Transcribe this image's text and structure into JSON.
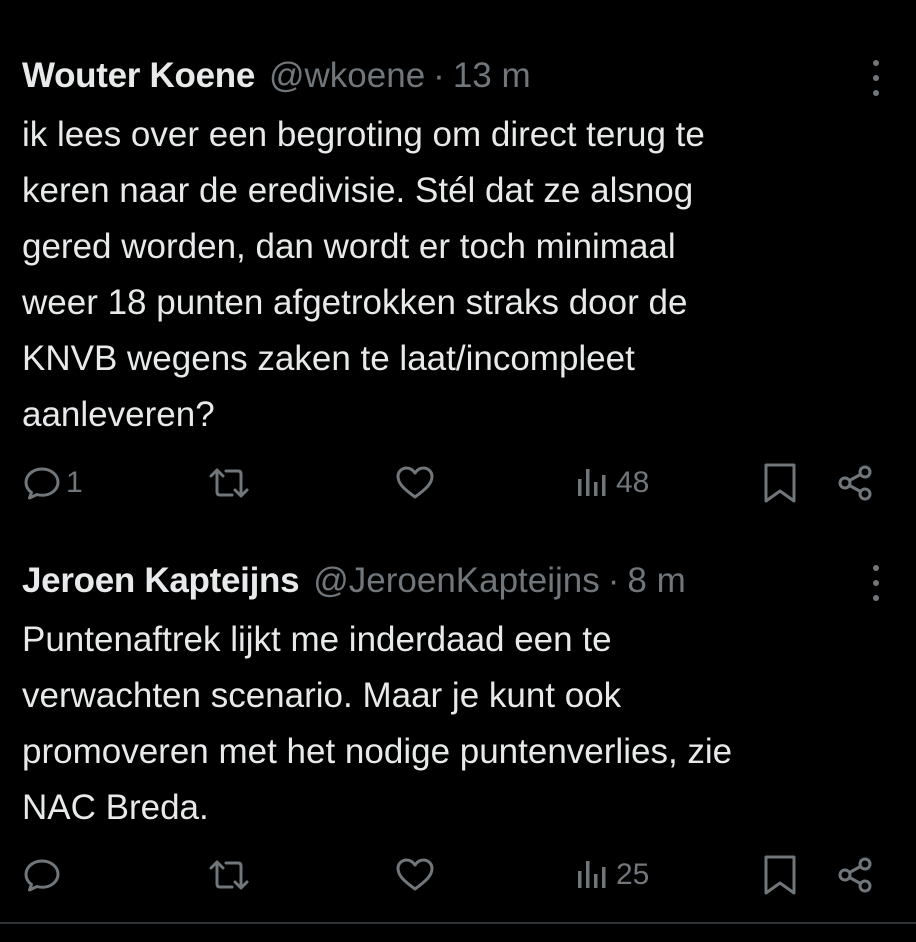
{
  "tweets": [
    {
      "display_name": "Wouter Koene",
      "handle": "@wkoene",
      "separator": "·",
      "time": "13 m",
      "text": "ik lees over een begroting om direct terug te\nkeren naar de eredivisie. Stél dat ze alsnog\ngered worden, dan wordt er toch minimaal\nweer 18 punten afgetrokken straks door de\nKNVB wegens zaken te laat/incompleet\naanleveren?",
      "replies": "1",
      "views": "48"
    },
    {
      "display_name": "Jeroen Kapteijns",
      "handle": "@JeroenKapteijns",
      "separator": "·",
      "time": "8 m",
      "text": "Puntenaftrek lijkt me inderdaad een te\nverwachten scenario. Maar je kunt ook\npromoveren met het nodige puntenverlies, zie\nNAC Breda.",
      "replies": "",
      "views": "25"
    }
  ],
  "icons": {
    "reply": "reply-icon",
    "retweet": "retweet-icon",
    "like": "heart-icon",
    "views": "views-icon",
    "bookmark": "bookmark-icon",
    "share": "share-icon",
    "more": "more-icon"
  },
  "colors": {
    "background": "#000000",
    "primary_text": "#e7e9ea",
    "secondary_text": "#71767b",
    "divider": "#2f3336"
  }
}
